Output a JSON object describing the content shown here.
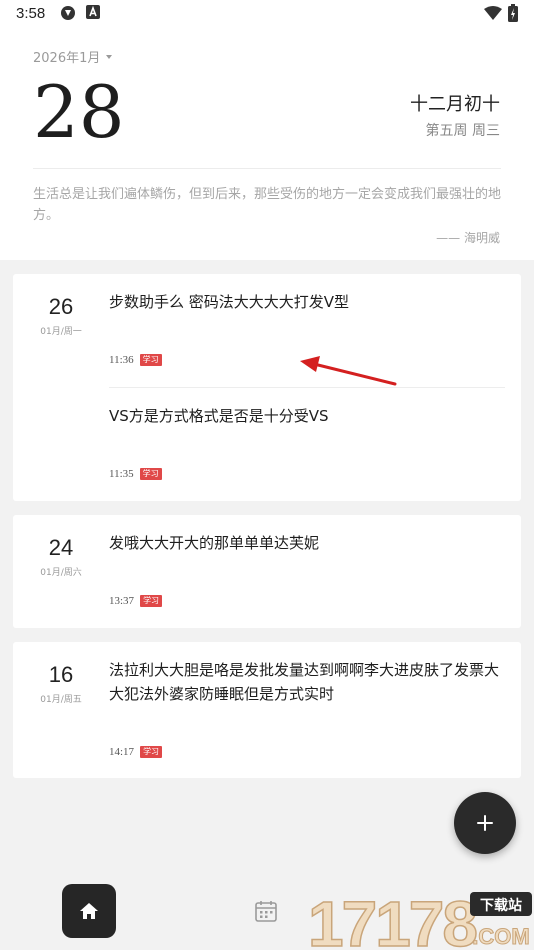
{
  "status_bar": {
    "time": "3:58"
  },
  "header": {
    "month_selector": "2026年1月",
    "day": "28",
    "lunar_date": "十二月初十",
    "week_info": "第五周 周三",
    "quote": "生活总是让我们遍体鳞伤，但到后来，那些受伤的地方一定会变成我们最强壮的地方。",
    "quote_author": "—— 海明威"
  },
  "cards": [
    {
      "day": "26",
      "sub": "01月/周一",
      "entries": [
        {
          "title": "步数助手么 密码法大大大大打发V型",
          "time": "11:36",
          "tag": "学习"
        },
        {
          "title": "VS方是方式格式是否是十分受VS",
          "time": "11:35",
          "tag": "学习"
        }
      ]
    },
    {
      "day": "24",
      "sub": "01月/周六",
      "entries": [
        {
          "title": "发哦大大开大的那单单单达芙妮",
          "time": "13:37",
          "tag": "学习"
        }
      ]
    },
    {
      "day": "16",
      "sub": "01月/周五",
      "entries": [
        {
          "title": "法拉利大大胆是咯是发批发量达到啊啊李大进皮肤了发票大大犯法外婆家防睡眠但是方式实时",
          "time": "14:17",
          "tag": "学习"
        }
      ]
    }
  ],
  "watermark": {
    "text": "17178",
    "badge": "下载站",
    "domain": ".COM"
  },
  "colors": {
    "accent": "#e04848",
    "fab": "#2a2a2a",
    "home": "#262626",
    "annotation_arrow": "#d42020"
  },
  "icons": [
    "recycle-icon",
    "a-box-icon",
    "wifi-icon",
    "battery-icon",
    "plus-icon",
    "home-icon",
    "calendar-icon"
  ]
}
